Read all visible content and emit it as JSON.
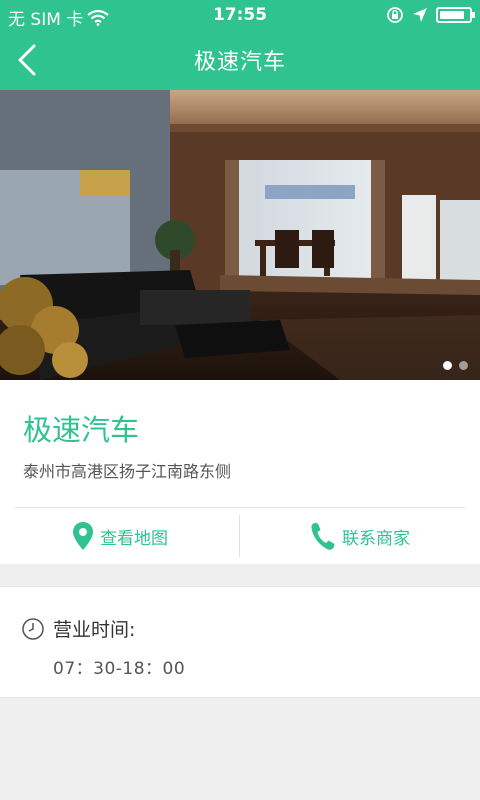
{
  "status": {
    "carrier": "无 SIM 卡",
    "time": "17:55",
    "battery_level": 0.85
  },
  "nav": {
    "title": "极速汽车",
    "back_icon": "chevron-left-icon"
  },
  "banner": {
    "slide_count": 2,
    "active_slide": 1
  },
  "shop": {
    "name": "极速汽车",
    "address": "泰州市高港区扬子江南路东侧"
  },
  "actions": {
    "map_label": "查看地图",
    "call_label": "联系商家",
    "map_icon": "location-pin-icon",
    "call_icon": "phone-icon"
  },
  "hours": {
    "title": "营业时间:",
    "value": "07：30-18：00",
    "icon": "clock-icon"
  },
  "colors": {
    "accent": "#2ec38f",
    "background": "#efefef"
  }
}
